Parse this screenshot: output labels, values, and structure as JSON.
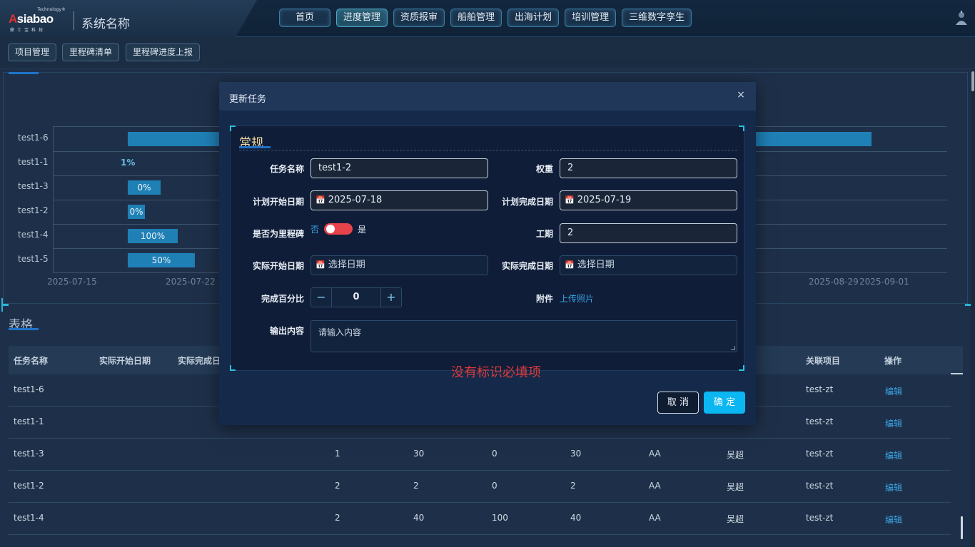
{
  "header": {
    "logo_tech": "Technology®",
    "logo_word_a": "A",
    "logo_word_rest": "siabao",
    "logo_cn": "鼎士宝科技",
    "system_name": "系统名称",
    "nav": [
      "首页",
      "进度管理",
      "资质报审",
      "船舶管理",
      "出海计划",
      "培训管理",
      "三维数字孪生"
    ],
    "nav_active_index": 1
  },
  "subnav": [
    "项目管理",
    "里程碑清单",
    "里程碑进度上报"
  ],
  "gantt": {
    "rows": [
      {
        "label": "test1-6",
        "bar_label": "",
        "start": 0.083,
        "end": 0.915
      },
      {
        "label": "test1-1",
        "bar_label": "1%",
        "start": null,
        "end": null
      },
      {
        "label": "test1-3",
        "bar_label": "0%",
        "start": 0.083,
        "end": 0.12
      },
      {
        "label": "test1-2",
        "bar_label": "0%",
        "start": 0.083,
        "end": 0.102
      },
      {
        "label": "test1-4",
        "bar_label": "100%",
        "start": 0.083,
        "end": 0.139
      },
      {
        "label": "test1-5",
        "bar_label": "50%",
        "start": 0.083,
        "end": 0.158
      }
    ],
    "axis_ticks": [
      "2025-07-15",
      "2025-07-22",
      "2025-08-29",
      "2025-09-01"
    ]
  },
  "table": {
    "title": "表格",
    "headers": [
      "任务名称",
      "实际开始日期",
      "实际完成日",
      "关联项目",
      "操作"
    ],
    "rows": [
      {
        "name": "test1-6",
        "c1": "",
        "c2": "",
        "c3": "",
        "c4": "",
        "c5": "",
        "c6": "",
        "project": "test-zt",
        "action": "编辑"
      },
      {
        "name": "test1-1",
        "c1": "",
        "c2": "",
        "c3": "",
        "c4": "",
        "c5": "",
        "c6": "",
        "project": "test-zt",
        "action": "编辑"
      },
      {
        "name": "test1-3",
        "c1": "1",
        "c2": "30",
        "c3": "0",
        "c4": "30",
        "c5": "AA",
        "c6": "吴超",
        "project": "test-zt",
        "action": "编辑"
      },
      {
        "name": "test1-2",
        "c1": "2",
        "c2": "2",
        "c3": "0",
        "c4": "2",
        "c5": "AA",
        "c6": "吴超",
        "project": "test-zt",
        "action": "编辑"
      },
      {
        "name": "test1-4",
        "c1": "2",
        "c2": "40",
        "c3": "100",
        "c4": "40",
        "c5": "AA",
        "c6": "吴超",
        "project": "test-zt",
        "action": "编辑"
      }
    ]
  },
  "modal": {
    "title": "更新任务",
    "close": "×",
    "group_title": "常规",
    "labels": {
      "task_name": "任务名称",
      "weight": "权重",
      "plan_start": "计划开始日期",
      "plan_end": "计划完成日期",
      "is_milestone": "是否为里程碑",
      "duration": "工期",
      "actual_start": "实际开始日期",
      "actual_end": "实际完成日期",
      "percent": "完成百分比",
      "attachment": "附件",
      "output": "输出内容"
    },
    "values": {
      "task_name": "test1-2",
      "weight": "2",
      "plan_start": "2025-07-18",
      "plan_end": "2025-07-19",
      "duration": "2",
      "percent": "0"
    },
    "placeholders": {
      "actual_start": "选择日期",
      "actual_end": "选择日期",
      "output": "请输入内容"
    },
    "switch": {
      "off_label": "否",
      "on_label": "是",
      "on": true
    },
    "upload_label": "上传照片",
    "note": "没有标识必填项",
    "cancel": "取 消",
    "ok": "确 定"
  },
  "colors": {
    "accent": "#0bb7f2",
    "switch_on": "#e8434b",
    "link": "#3aa6e8",
    "note": "#e03a3a"
  },
  "icons": [
    "calendar-icon",
    "user-icon",
    "close-icon",
    "minus-icon",
    "plus-icon"
  ]
}
